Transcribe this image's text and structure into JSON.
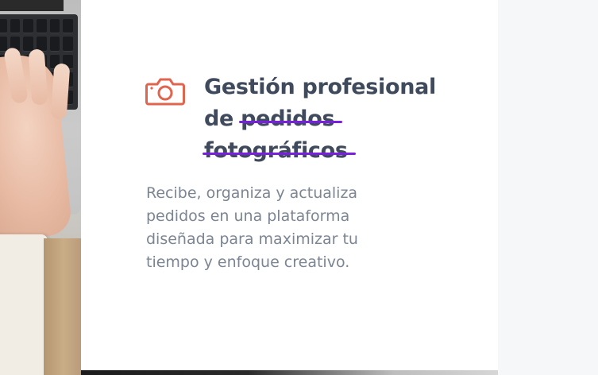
{
  "feature": {
    "icon": "camera-icon",
    "title_line1": "Gestión profesional",
    "title_prefix": "de",
    "struck_word1": "pedidos",
    "struck_word2": "fotográficos",
    "description": "Recibe, organiza y actualiza pedidos en una plataforma diseñada para maximizar tu tiempo y enfoque creativo."
  },
  "colors": {
    "icon": "#e0654e",
    "title": "#3f4a5c",
    "strike": "#7a1fe0",
    "description": "#7b8593",
    "background": "#f6f7f9",
    "card": "#ffffff"
  }
}
